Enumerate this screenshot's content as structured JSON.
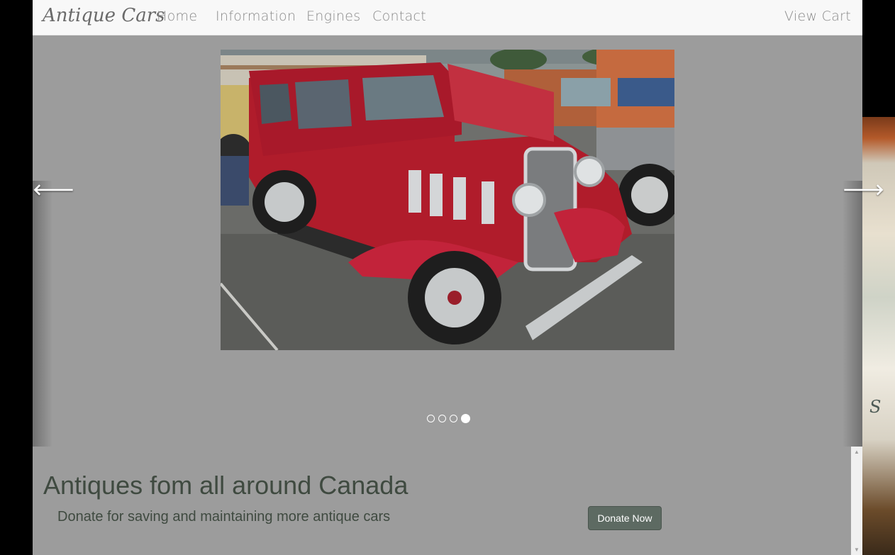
{
  "nav": {
    "brand": "Antique Cars",
    "links": [
      "Home",
      "Information",
      "Engines",
      "Contact"
    ],
    "cart": "View Cart"
  },
  "carousel": {
    "prev_glyph": "🡐",
    "next_glyph": "🡒",
    "slide_count": 4,
    "active_index": 3,
    "slide_icon": "red-vintage-car-photo"
  },
  "jumbotron": {
    "headline": "Antiques fom all around Canada",
    "subline": "Donate for saving and maintaining more antique cars",
    "button": "Donate Now"
  },
  "colors": {
    "navbar": "#f8f8f8",
    "page_bg": "#9c9c9c",
    "text_dark": "#3f4a40",
    "button": "#5d6a62"
  }
}
